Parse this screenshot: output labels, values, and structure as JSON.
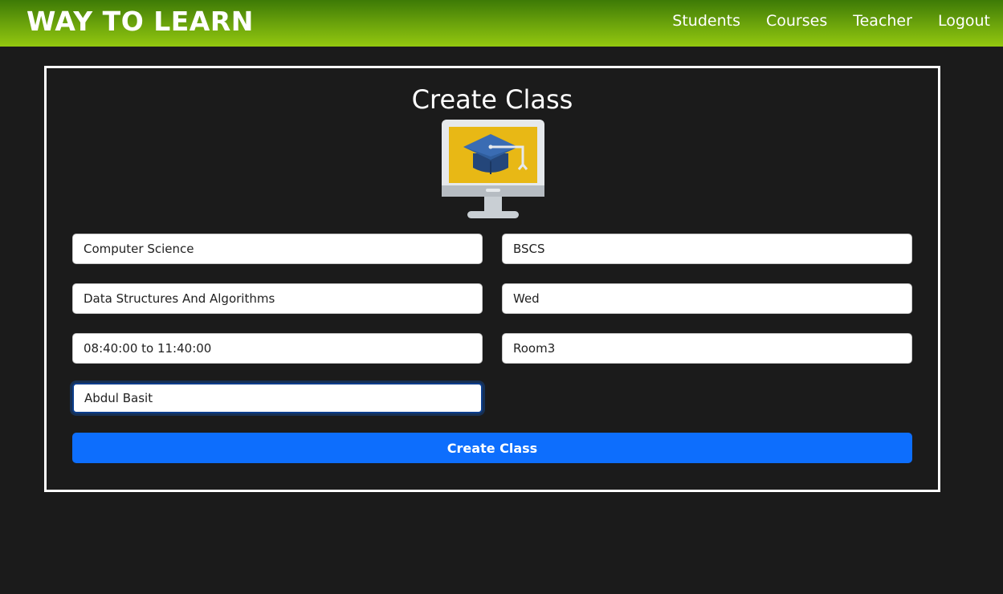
{
  "navbar": {
    "brand": "WAY TO LEARN",
    "links": [
      "Students",
      "Courses",
      "Teacher",
      "Logout"
    ]
  },
  "form": {
    "title": "Create Class",
    "icon": "monitor-graduation-cap-icon",
    "fields": {
      "department": "Computer Science",
      "program": "BSCS",
      "course": "Data Structures And Algorithms",
      "day": "Wed",
      "time": "08:40:00 to 11:40:00",
      "room": "Room3",
      "teacher": "Abdul Basit"
    },
    "submit_label": "Create Class"
  },
  "colors": {
    "navbar_dark": "#3d7a06",
    "navbar_light": "#93c80f",
    "background": "#1b1b1b",
    "button": "#0d6efd",
    "icon_screen": "#e8b815",
    "icon_cap": "#2f5d9c"
  }
}
